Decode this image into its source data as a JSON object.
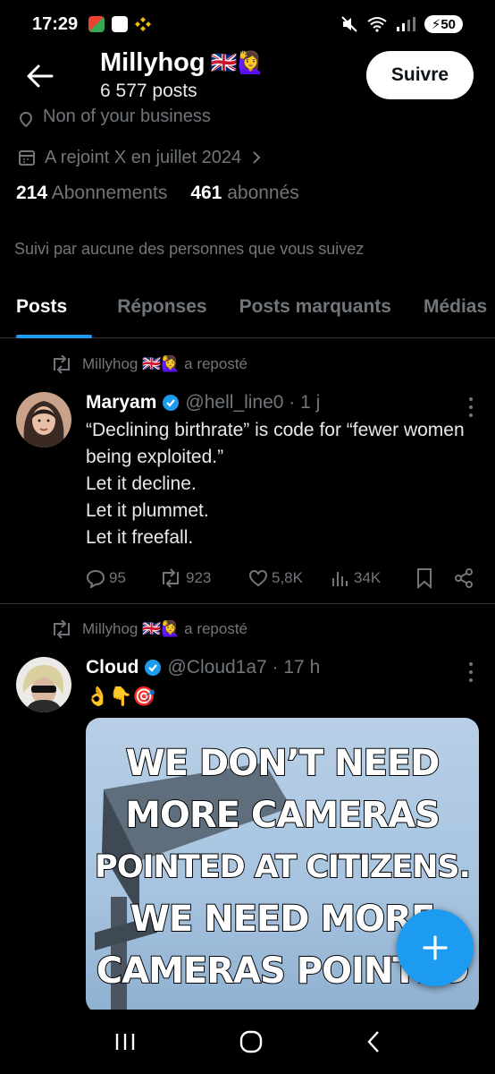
{
  "status_bar": {
    "time": "17:29",
    "battery": "50"
  },
  "header": {
    "name": "Millyhog",
    "name_emojis": "🇬🇧🙋‍♀️",
    "posts_count": "6 577 posts",
    "follow_label": "Suivre"
  },
  "profile": {
    "location_partial": "Non of your business",
    "joined": "A rejoint X en juillet 2024",
    "following_count": "214",
    "following_label": "Abonnements",
    "followers_count": "461",
    "followers_label": "abonnés",
    "followed_by": "Suivi par aucune des personnes que vous suivez"
  },
  "tabs": [
    {
      "label": "Posts"
    },
    {
      "label": "Réponses"
    },
    {
      "label": "Posts marquants"
    },
    {
      "label": "Médias"
    }
  ],
  "posts": [
    {
      "repost_by": "Millyhog 🇬🇧🙋‍♀️ a reposté",
      "author": "Maryam",
      "handle": "@hell_line0 · 1 j",
      "lines": [
        "“Declining birthrate” is code for “fewer women being exploited.”",
        "Let it decline.",
        "Let it plummet.",
        "Let it freefall."
      ],
      "replies": "95",
      "reposts": "923",
      "likes": "5,8K",
      "views": "34K"
    },
    {
      "repost_by": "Millyhog 🇬🇧🙋‍♀️ a reposté",
      "author": "Cloud",
      "handle": "@Cloud1a7 · 17 h",
      "text": "👌👇🎯",
      "media_text": [
        "WE DON’T NEED",
        "MORE CAMERAS",
        "POINTED AT CITIZENS.",
        "WE NEED MORE",
        "CAMERAS POINTED"
      ]
    }
  ],
  "colors": {
    "accent": "#1d9bf0",
    "background": "#000000",
    "muted": "#71767b"
  }
}
